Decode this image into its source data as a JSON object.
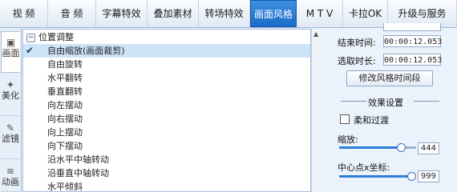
{
  "top_tabs": [
    "视 频",
    "音 频",
    "字幕特效",
    "叠加素材",
    "转场特效",
    "画面风格",
    "M T V",
    "卡拉OK",
    "升级与服务"
  ],
  "active_top_tab": "画面风格",
  "side_tabs": [
    {
      "label": "画面",
      "icon": "picture-icon"
    },
    {
      "label": "美化",
      "icon": "wrench-icon"
    },
    {
      "label": "滤镜",
      "icon": "brush-icon"
    },
    {
      "label": "动画",
      "icon": "wave-icon"
    }
  ],
  "tree": {
    "group_label": "位置调整",
    "items": [
      "自由缩放(画面裁剪)",
      "自由旋转",
      "水平翻转",
      "垂直翻转",
      "向左摆动",
      "向右摆动",
      "向上摆动",
      "向下摆动",
      "沿水平中轴转动",
      "沿垂直中轴转动",
      "水平倾斜"
    ],
    "selected_index": 0
  },
  "right_panel": {
    "end_time_label": "结束时间:",
    "end_time_value": "00:00:12.053",
    "duration_label": "选取时长:",
    "duration_value": "00:00:12.053",
    "modify_button": "修改风格时间段",
    "effect_section": "效果设置",
    "fade_label": "柔和过渡",
    "fade_checked": false,
    "zoom_label": "缩放:",
    "zoom_value": "444",
    "zoom_fraction": 0.8,
    "center_x_label": "中心点x坐标:",
    "center_x_value": "999",
    "center_x_fraction": 1.0
  },
  "colors": {
    "accent": "#1b6cc9",
    "selected_row": "#cde3f8",
    "panel_bg": "#eaf2fb"
  }
}
